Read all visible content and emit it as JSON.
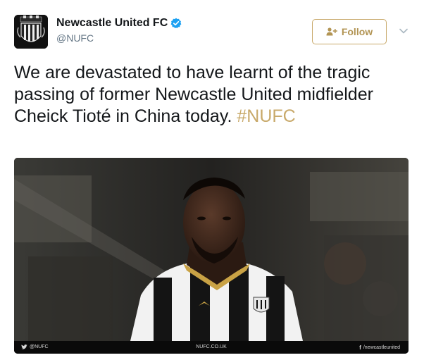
{
  "account": {
    "display_name": "Newcastle United FC",
    "handle": "@NUFC",
    "verified": true
  },
  "follow_button": {
    "label": "Follow"
  },
  "tweet": {
    "text": "We are devastated to have learnt of the tragic passing of former Newcastle United midfielder Cheick Tioté in China today.",
    "hashtag": "#NUFC"
  },
  "media": {
    "footer_left": "@NUFC",
    "footer_center": "NUFC.CO.UK",
    "footer_right": "/newcastleunited"
  },
  "colors": {
    "accent_gold": "#c8a96a",
    "verified_blue": "#1da1f2",
    "text_primary": "#14171a",
    "text_secondary": "#657786"
  },
  "icons": {
    "avatar": "newcastle-crest",
    "verified": "verified-badge-icon",
    "follow": "add-user-icon",
    "menu": "chevron-down-icon",
    "footer_left": "twitter-bird-icon",
    "footer_right": "facebook-icon"
  }
}
